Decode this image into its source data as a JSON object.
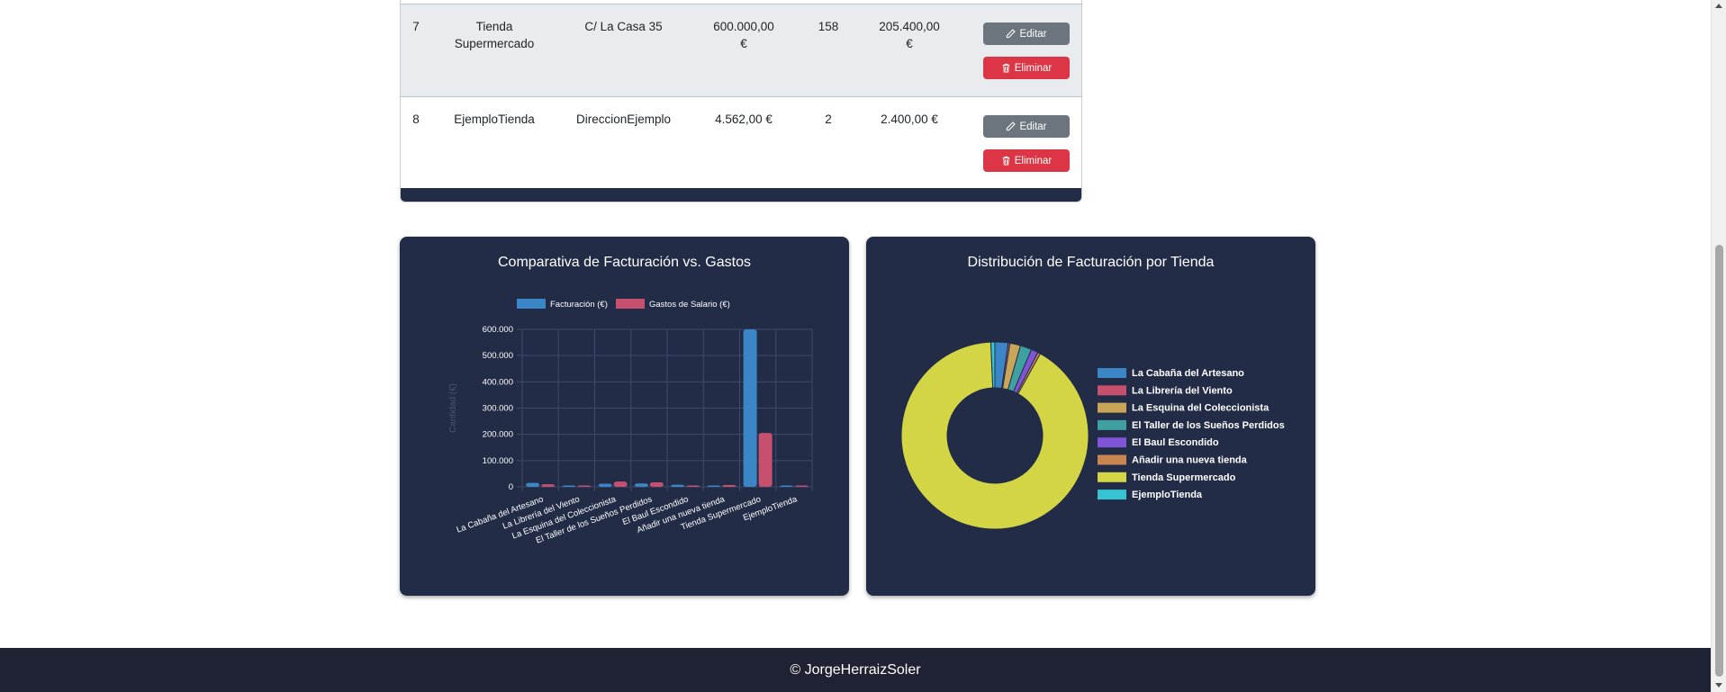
{
  "table": {
    "rows": [
      {
        "id": "7",
        "name_line1": "Tienda",
        "name_line2": "Supermercado",
        "address": "C/ La Casa 35",
        "billing_line1": "600.000,00",
        "billing_line2": "€",
        "employees": "158",
        "salary_line1": "205.400,00",
        "salary_line2": "€",
        "edit_label": "Editar",
        "delete_label": "Eliminar"
      },
      {
        "id": "8",
        "name_line1": "EjemploTienda",
        "name_line2": "",
        "address": "DireccionEjemplo",
        "billing_line1": "4.562,00 €",
        "billing_line2": "",
        "employees": "2",
        "salary_line1": "2.400,00 €",
        "salary_line2": "",
        "edit_label": "Editar",
        "delete_label": "Eliminar"
      }
    ]
  },
  "bar_card": {
    "title": "Comparativa de Facturación vs. Gastos"
  },
  "pie_card": {
    "title": "Distribución de Facturación por Tienda"
  },
  "chart_data": [
    {
      "type": "bar",
      "title": "Comparativa de Facturación vs. Gastos",
      "categories": [
        "La Cabaña del Artesano",
        "La Librería del Viento",
        "La Esquina del Coleccionista",
        "El Taller de los Sueños Perdidos",
        "El Baul Escondido",
        "Añadir una nueva tienda",
        "Tienda Supermercado",
        "EjemploTienda"
      ],
      "series": [
        {
          "name": "Facturación (€)",
          "values": [
            15000,
            2000,
            12000,
            13000,
            8000,
            3000,
            600000,
            4562
          ],
          "color": "#3b86c6"
        },
        {
          "name": "Gastos de Salario (€)",
          "values": [
            10000,
            3000,
            20000,
            17000,
            5000,
            7000,
            205400,
            2400
          ],
          "color": "#c7506f"
        }
      ],
      "ylabel": "Cantidad (€)",
      "ylim": [
        0,
        600000
      ],
      "yticks": [
        "0",
        "100.000",
        "200.000",
        "300.000",
        "400.000",
        "500.000",
        "600.000"
      ],
      "grid": true,
      "legend": "top"
    },
    {
      "type": "pie",
      "title": "Distribución de Facturación por Tienda",
      "labels": [
        "La Cabaña del Artesano",
        "La Librería del Viento",
        "La Esquina del Coleccionista",
        "El Taller de los Sueños Perdidos",
        "El Baul Escondido",
        "Añadir una nueva tienda",
        "Tienda Supermercado",
        "EjemploTienda"
      ],
      "values": [
        15000,
        2000,
        12000,
        13000,
        8000,
        3000,
        600000,
        4562
      ],
      "colors": [
        "#3b86c6",
        "#c7506f",
        "#c9a557",
        "#3fa0a0",
        "#8054d6",
        "#c98550",
        "#d4d545",
        "#36c4d2"
      ],
      "legend": "right"
    }
  ],
  "footer": {
    "text": "© JorgeHerraizSoler"
  }
}
